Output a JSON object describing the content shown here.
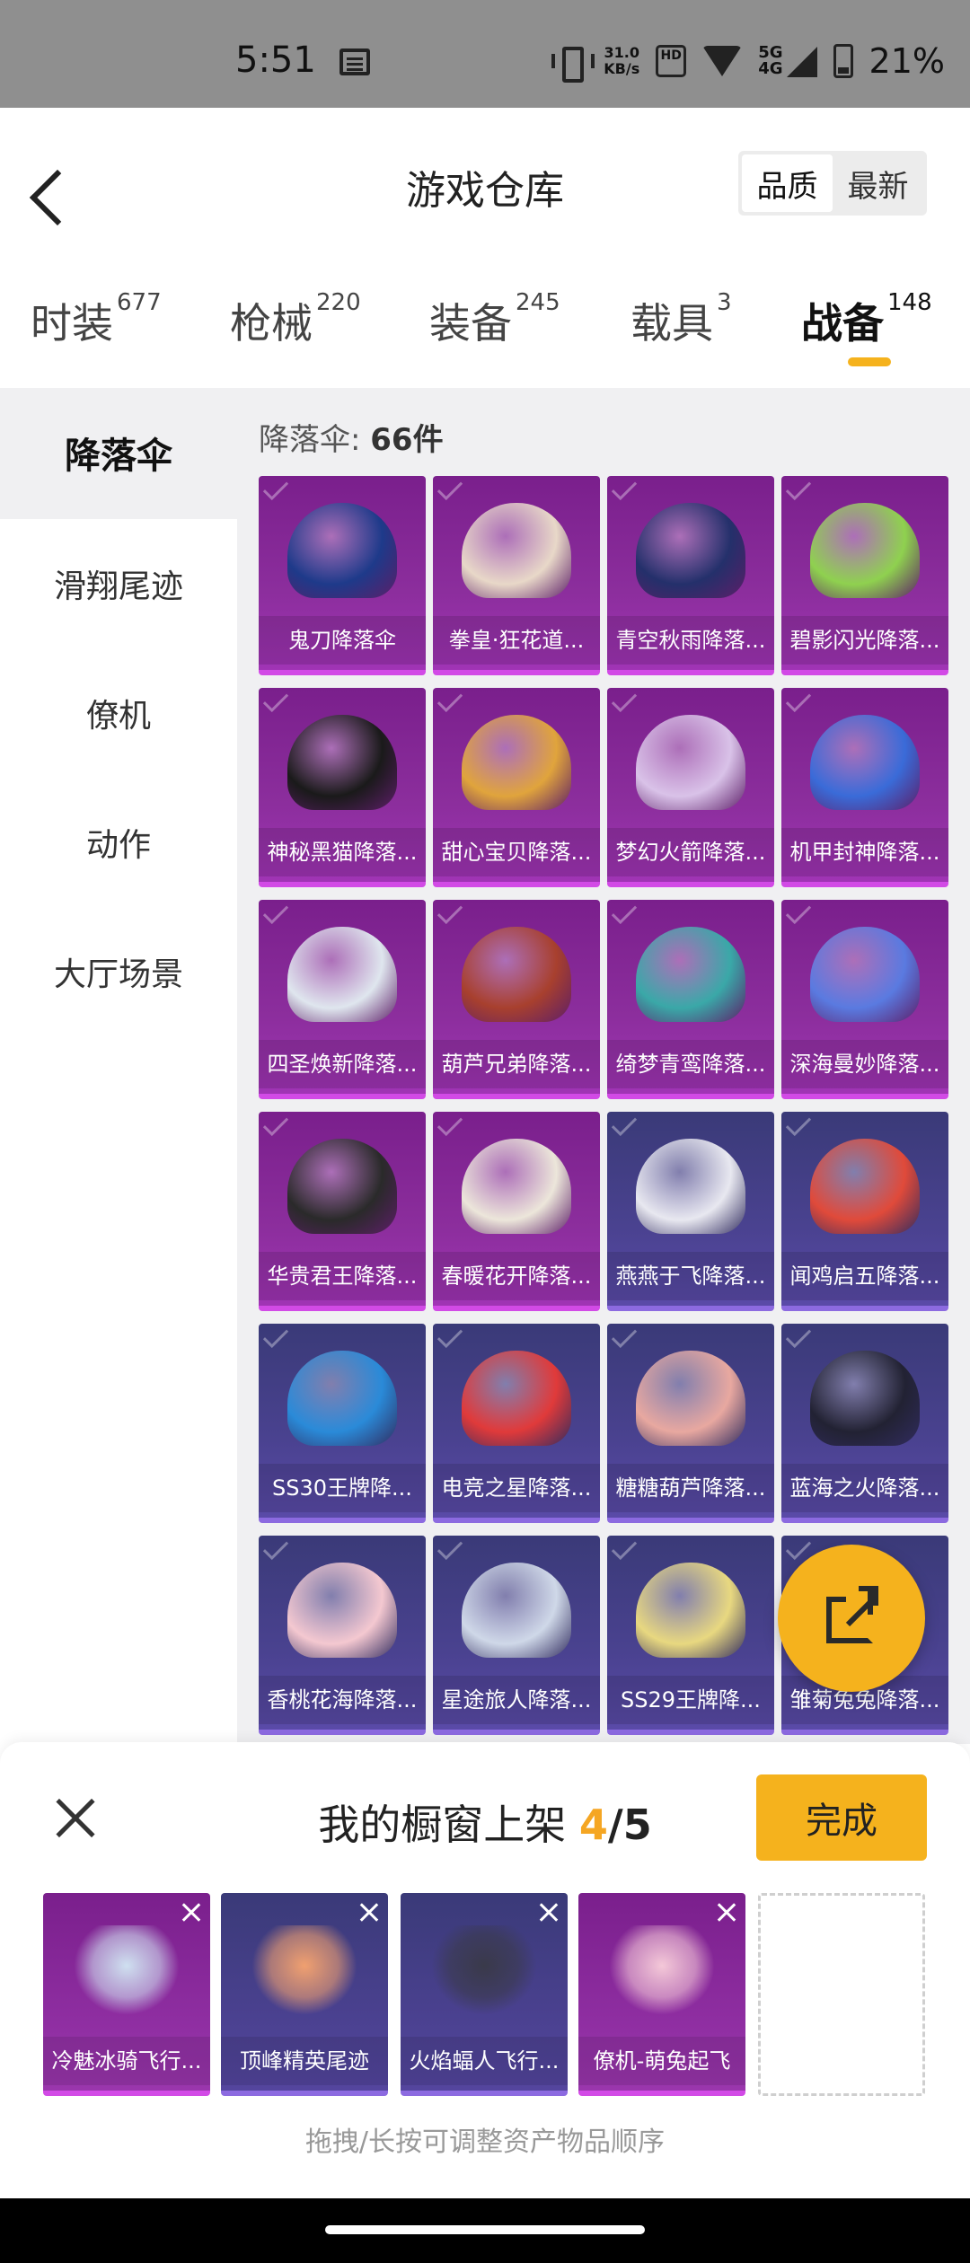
{
  "status": {
    "time": "5:51",
    "net_speed_value": "31.0",
    "net_speed_unit": "KB/s",
    "hd_label": "HD",
    "sig_top": "5G",
    "sig_bottom": "4G",
    "battery": "21%"
  },
  "header": {
    "title": "游戏仓库",
    "sort_options": [
      "品质",
      "最新"
    ]
  },
  "tabs": [
    {
      "label": "时装",
      "count": "677"
    },
    {
      "label": "枪械",
      "count": "220"
    },
    {
      "label": "装备",
      "count": "245"
    },
    {
      "label": "载具",
      "count": "3"
    },
    {
      "label": "战备",
      "count": "148"
    }
  ],
  "sidebar": {
    "items": [
      "降落伞",
      "滑翔尾迹",
      "僚机",
      "动作",
      "大厅场景"
    ]
  },
  "list": {
    "count_prefix": "降落伞: ",
    "count_value": "66件"
  },
  "items": [
    {
      "name": "鬼刀降落伞",
      "tier": "purple",
      "color": "#1e3a8a"
    },
    {
      "name": "拳皇·狂花道...",
      "tier": "purple",
      "color": "#e8d8c8"
    },
    {
      "name": "青空秋雨降落...",
      "tier": "purple",
      "color": "#24306b"
    },
    {
      "name": "碧影闪光降落...",
      "tier": "purple",
      "color": "#8fd14f"
    },
    {
      "name": "神秘黑猫降落...",
      "tier": "purple",
      "color": "#1a1a1a"
    },
    {
      "name": "甜心宝贝降落...",
      "tier": "purple",
      "color": "#e0a43c"
    },
    {
      "name": "梦幻火箭降落...",
      "tier": "purple",
      "color": "#d9c2e8"
    },
    {
      "name": "机甲封神降落...",
      "tier": "purple",
      "color": "#3a6bd8"
    },
    {
      "name": "四圣焕新降落...",
      "tier": "purple",
      "color": "#dfe6ee"
    },
    {
      "name": "葫芦兄弟降落...",
      "tier": "purple",
      "color": "#a8402e"
    },
    {
      "name": "绮梦青鸾降落...",
      "tier": "purple",
      "color": "#3aa8a8"
    },
    {
      "name": "深海曼妙降落...",
      "tier": "purple",
      "color": "#5a7ae0"
    },
    {
      "name": "华贵君王降落...",
      "tier": "purple",
      "color": "#2a2a2a"
    },
    {
      "name": "春暖花开降落...",
      "tier": "purple",
      "color": "#ece6da"
    },
    {
      "name": "燕燕于飞降落...",
      "tier": "blue",
      "color": "#e8e8f0"
    },
    {
      "name": "闻鸡启五降落...",
      "tier": "blue",
      "color": "#e04a3a"
    },
    {
      "name": "SS30王牌降...",
      "tier": "blue",
      "color": "#2a8ad8"
    },
    {
      "name": "电竞之星降落...",
      "tier": "blue",
      "color": "#e03a3a"
    },
    {
      "name": "糖糖葫芦降落...",
      "tier": "blue",
      "color": "#e8a8a0"
    },
    {
      "name": "蓝海之火降落...",
      "tier": "blue",
      "color": "#222233"
    },
    {
      "name": "香桃花海降落...",
      "tier": "blue",
      "color": "#f4c8d0"
    },
    {
      "name": "星途旅人降落...",
      "tier": "blue",
      "color": "#cfd8e8"
    },
    {
      "name": "SS29王牌降...",
      "tier": "blue",
      "color": "#e8d880"
    },
    {
      "name": "雏菊兔兔降落...",
      "tier": "blue",
      "color": "#f0e8e0"
    }
  ],
  "showcase": {
    "title": "我的橱窗上架 ",
    "current": "4",
    "sep_total": "/5",
    "done_label": "完成",
    "slots": [
      {
        "name": "冷魅冰骑飞行...",
        "tier": "purple",
        "color": "#cfe0f0"
      },
      {
        "name": "顶峰精英尾迹",
        "tier": "blue",
        "color": "#f0a070"
      },
      {
        "name": "火焰蝠人飞行...",
        "tier": "blue",
        "color": "#3a3a4a"
      },
      {
        "name": "僚机-萌兔起飞",
        "tier": "purple",
        "color": "#f4c8d8"
      }
    ],
    "hint": "拖拽/长按可调整资产物品顺序"
  }
}
